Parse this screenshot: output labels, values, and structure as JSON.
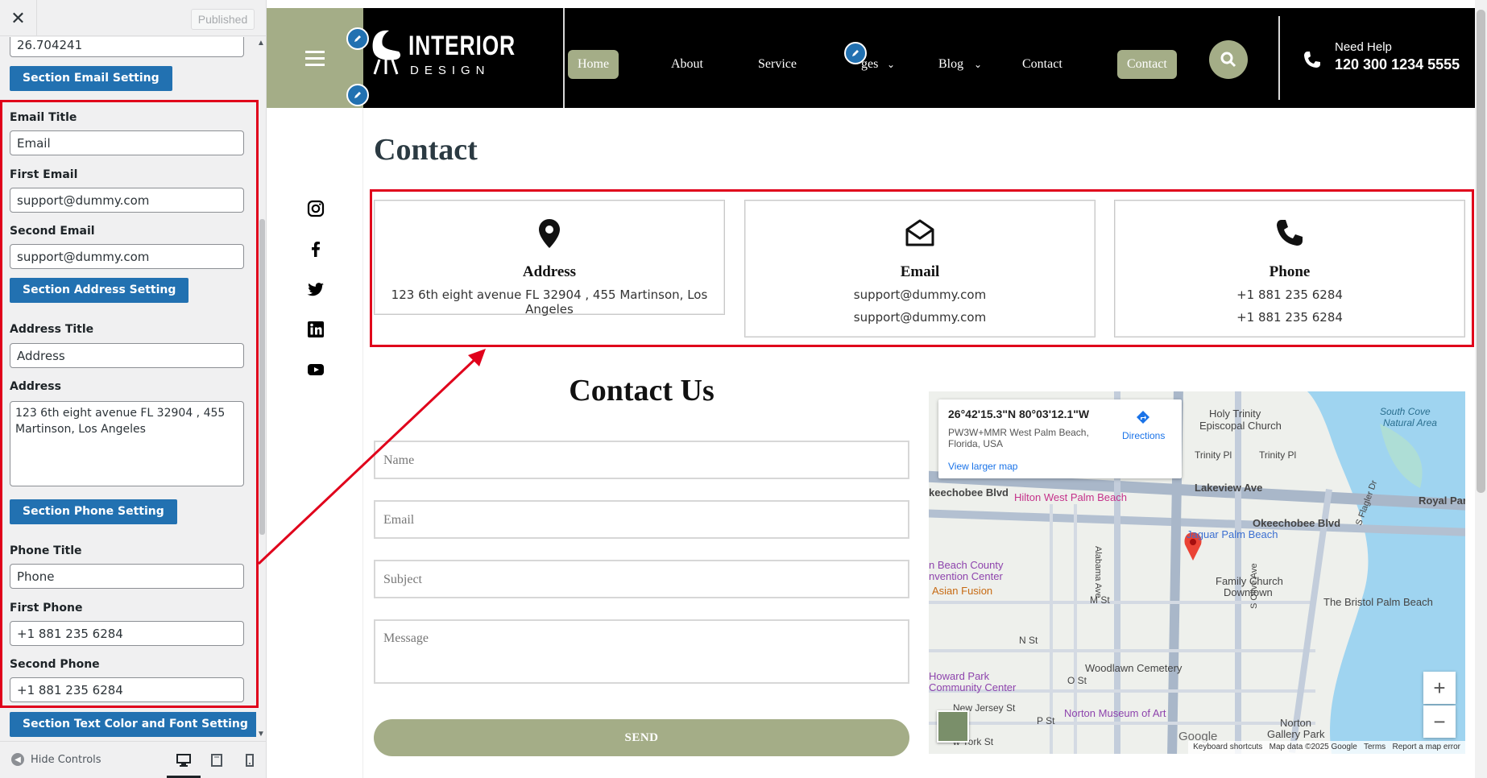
{
  "customizer": {
    "published_label": "Published",
    "latitude_value": "26.704241",
    "section_email_btn": "Section Email Setting",
    "email_title_label": "Email Title",
    "email_title_value": "Email",
    "first_email_label": "First Email",
    "first_email_value": "support@dummy.com",
    "second_email_label": "Second Email",
    "second_email_value": "support@dummy.com",
    "section_address_btn": "Section Address Setting",
    "address_title_label": "Address Title",
    "address_title_value": "Address",
    "address_label": "Address",
    "address_value": "123 6th eight avenue FL 32904 , 455 Martinson, Los Angeles",
    "section_phone_btn": "Section Phone Setting",
    "phone_title_label": "Phone Title",
    "phone_title_value": "Phone",
    "first_phone_label": "First Phone",
    "first_phone_value": "+1 881 235 6284",
    "second_phone_label": "Second Phone",
    "second_phone_value": "+1 881 235 6284",
    "section_text_btn": "Section Text Color and Font Setting",
    "hide_controls": "Hide Controls"
  },
  "header": {
    "logo_line1": "INTERIOR",
    "logo_line2": "DESIGN",
    "nav": [
      "Home",
      "About",
      "Service",
      "ges",
      "Blog",
      "Contact"
    ],
    "cta": "Contact",
    "need_help": "Need Help",
    "phone": "120 300 1234 5555"
  },
  "page": {
    "title": "Contact",
    "cards": [
      {
        "title": "Address",
        "lines": [
          "123 6th eight avenue FL 32904 , 455 Martinson, Los Angeles"
        ]
      },
      {
        "title": "Email",
        "lines": [
          "support@dummy.com",
          "support@dummy.com"
        ]
      },
      {
        "title": "Phone",
        "lines": [
          "+1 881 235 6284",
          "+1 881 235 6284"
        ]
      }
    ],
    "contact_us": "Contact Us",
    "form": {
      "name": "Name",
      "email": "Email",
      "subject": "Subject",
      "message": "Message",
      "send": "SEND"
    }
  },
  "map": {
    "coords": "26°42'15.3\"N 80°03'12.1\"W",
    "address": "PW3W+MMR West Palm Beach, Florida, USA",
    "directions": "Directions",
    "larger": "View larger map",
    "labels": [
      "Holy Trinity",
      "Episcopal Church",
      "South Cove",
      "Natural Area",
      "Trinity Pl",
      "Lakeview Ave",
      "Royal Par",
      "Okeechobee Blvd",
      "Hilton West Palm Beach",
      "keechobee Blvd",
      "Jaguar Palm Beach",
      "n Beach County",
      "nvention Center",
      "Asian Fusion",
      "Family Church",
      "Downtown",
      "The Bristol Palm Beach",
      "M St",
      "N St",
      "O St",
      "P St",
      "Woodlawn Cemetery",
      "Howard Park",
      "Community Center",
      "New Jersey St",
      "Norton Museum of Art",
      "Norton",
      "Gallery Park",
      "w York St",
      "Alabama Ave",
      "S Olive Ave",
      "S Flagler Dr"
    ],
    "footer": [
      "Keyboard shortcuts",
      "Map data ©2025 Google",
      "Terms",
      "Report a map error"
    ],
    "google": "Google"
  },
  "colors": {
    "accent": "#a4ad87",
    "wp_blue": "#2271b1",
    "annotation_red": "#e0001b"
  }
}
